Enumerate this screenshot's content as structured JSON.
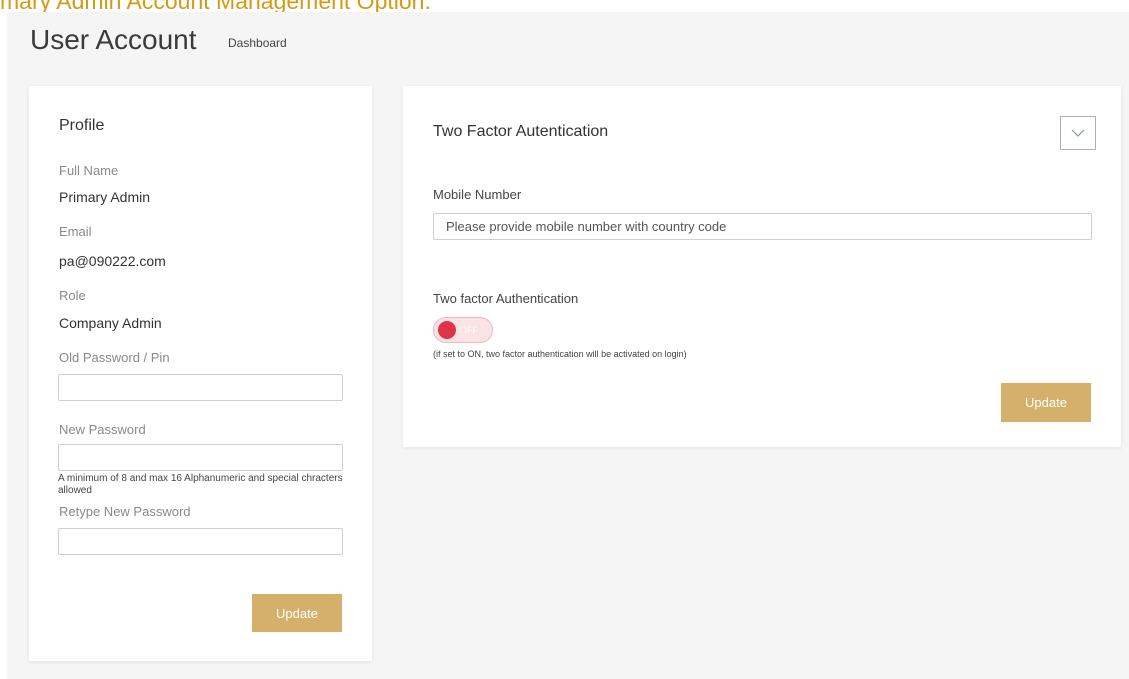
{
  "caption": "mary Admin Account Management Option.",
  "header": {
    "title": "User Account",
    "breadcrumb": "Dashboard"
  },
  "profile": {
    "title": "Profile",
    "full_name_label": "Full Name",
    "full_name_value": "Primary Admin",
    "email_label": "Email",
    "email_value": "pa@090222.com",
    "role_label": "Role",
    "role_value": "Company Admin",
    "old_password_label": "Old Password / Pin",
    "old_password_value": "",
    "new_password_label": "New Password",
    "new_password_value": "",
    "password_help": "A minimum of 8 and max 16 Alphanumeric and special chracters allowed",
    "retype_password_label": "Retype New Password",
    "retype_password_value": "",
    "update_label": "Update"
  },
  "two_factor": {
    "title": "Two Factor Autentication",
    "collapse_icon": "chevron-down-icon",
    "mobile_label": "Mobile Number",
    "mobile_value": "",
    "mobile_placeholder": "Please provide mobile number with country code",
    "toggle_section_label": "Two factor Authentication",
    "toggle_state": "OFF",
    "toggle_help": "(if set to ON, two factor authentication will be activated on login)",
    "update_label": "Update"
  },
  "colors": {
    "accent": "#d4b06a",
    "toggle_off": "#e0334a",
    "caption": "#d49a16"
  }
}
